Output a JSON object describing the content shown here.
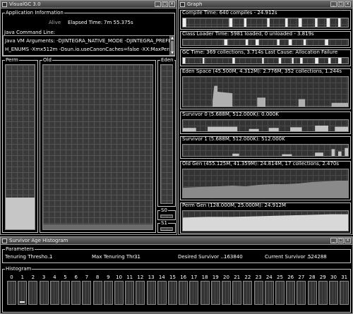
{
  "visualgc": {
    "title": "VisualGC 3.0",
    "app_info_label": "Application Information",
    "status": "Alive",
    "elapsed_label": "Elapsed Time:",
    "elapsed_value": "7m 55.375s",
    "cmdline_label": "Java Command Line:",
    "vm_args_line1": "Java VM Arguments: -DJINTEGRA_NATIVE_MODE -DJINTEGRA_PREFETC",
    "vm_args_line2": "H_ENUMS -Xmx512m -Dsun.io.useCanonCaches=false -XX:MaxPermSiz",
    "spaces": {
      "perm": "Perm",
      "old": "Old",
      "eden": "Eden",
      "s0": "S0",
      "s1": "S1"
    },
    "levels": {
      "perm": 0.195,
      "old": 0.03,
      "eden": 0.0,
      "s0": 0.0,
      "s1": 0.1
    }
  },
  "graph": {
    "title": "Graph",
    "panels": [
      {
        "key": "compile",
        "label": "Compile Time: 640 compiles - 24.912s"
      },
      {
        "key": "classloader",
        "label": "Class Loader Time: 5981 loaded, 0 unloaded - 3.819s"
      },
      {
        "key": "gc",
        "label": "GC Time: 369 collections, 3.714s  Last Cause: Allocation Failure"
      },
      {
        "key": "eden",
        "label": "Eden Space (45.500M, 4.312M): 2.776M, 352 collections, 1.244s"
      },
      {
        "key": "s0",
        "label": "Survivor 0 (5.688M, 512.000K): 0.000K"
      },
      {
        "key": "s1",
        "label": "Survivor 1 (5.688M, 512.000K): 512.000K"
      },
      {
        "key": "old",
        "label": "Old Gen (455.125M, 41.359M): 24.814M, 17 collections, 2.470s"
      },
      {
        "key": "perm",
        "label": "Perm Gen (128.000M, 25.000M): 24.912M"
      }
    ]
  },
  "histogram_window": {
    "title": "Survivor Age Histogram",
    "params_label": "Parameters",
    "params": [
      {
        "label": "Tenuring Thresho...",
        "value": "1"
      },
      {
        "label": "Max Tenuring Thr...",
        "value": "31"
      },
      {
        "label": "Desired Survivor ...",
        "value": "163840"
      },
      {
        "label": "Current Survivor ...",
        "value": "524288"
      }
    ],
    "histogram_label": "Histogram",
    "ages": [
      "0",
      "1",
      "2",
      "3",
      "4",
      "5",
      "6",
      "7",
      "8",
      "9",
      "10",
      "11",
      "12",
      "13",
      "14",
      "15",
      "16",
      "17",
      "18",
      "19",
      "20",
      "21",
      "22",
      "23",
      "24",
      "25",
      "26",
      "27",
      "28",
      "29",
      "30",
      "31"
    ],
    "age_fill": [
      0,
      0.08,
      0,
      0,
      0,
      0,
      0,
      0,
      0,
      0,
      0,
      0,
      0,
      0,
      0,
      0,
      0,
      0,
      0,
      0,
      0,
      0,
      0,
      0,
      0,
      0,
      0,
      0,
      0,
      0,
      0,
      0
    ]
  },
  "icons": {
    "close": "×",
    "minimize": "_",
    "maximize": "□"
  }
}
